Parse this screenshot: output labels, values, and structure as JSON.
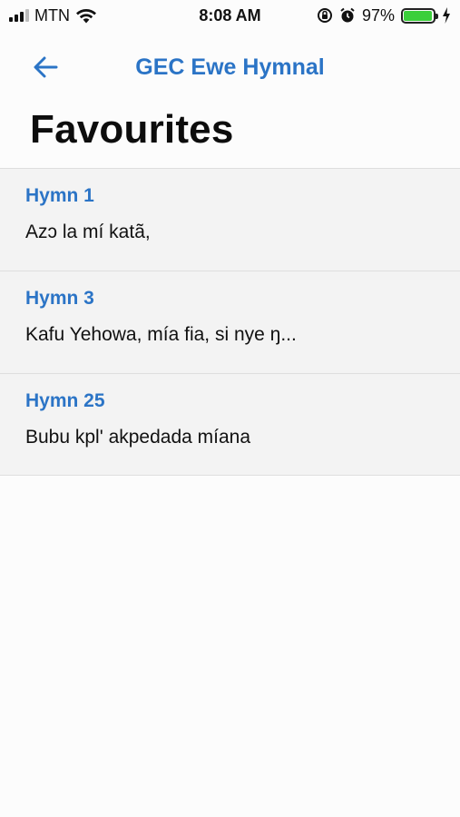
{
  "status_bar": {
    "carrier": "MTN",
    "time": "8:08 AM",
    "battery_percent": "97%",
    "battery_level": 0.97
  },
  "nav": {
    "title": "GEC Ewe Hymnal",
    "back_icon": "arrow-left-icon"
  },
  "page": {
    "title": "Favourites"
  },
  "favourites": [
    {
      "number": "Hymn 1",
      "first_line": "Azɔ la mí katã,"
    },
    {
      "number": "Hymn 3",
      "first_line": "Kafu Yehowa, mía fia, si nye ŋ..."
    },
    {
      "number": "Hymn 25",
      "first_line": "Bubu kpl' akpedada míana"
    }
  ],
  "colors": {
    "accent": "#2b74c6",
    "battery": "#3ccf3c"
  }
}
